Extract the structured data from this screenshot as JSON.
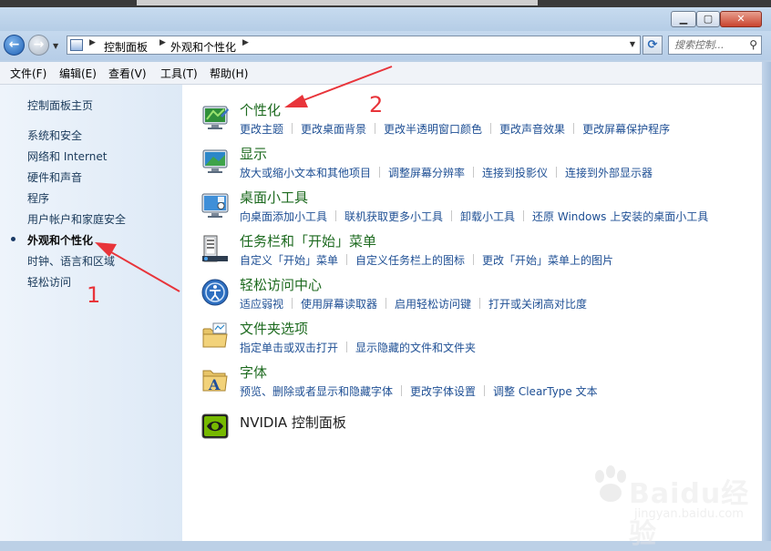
{
  "toolbar": {
    "search_placeholder": "搜索控制..."
  },
  "breadcrumb": {
    "part1": "控制面板",
    "part2": "外观和个性化"
  },
  "menu": [
    "文件(F)",
    "编辑(E)",
    "查看(V)",
    "工具(T)",
    "帮助(H)"
  ],
  "window_buttons": {
    "minimize": "▁",
    "maximize": "▢",
    "close": "✕"
  },
  "sidebar": {
    "home": "控制面板主页",
    "items": [
      "系统和安全",
      "网络和 Internet",
      "硬件和声音",
      "程序",
      "用户帐户和家庭安全",
      "外观和个性化",
      "时钟、语言和区域",
      "轻松访问"
    ],
    "active_index": 5
  },
  "categories": [
    {
      "title": "个性化",
      "icon": "personalization-icon",
      "links": [
        "更改主题",
        "更改桌面背景",
        "更改半透明窗口颜色",
        "更改声音效果",
        "更改屏幕保护程序"
      ]
    },
    {
      "title": "显示",
      "icon": "display-icon",
      "links": [
        "放大或缩小文本和其他项目",
        "调整屏幕分辨率",
        "连接到投影仪",
        "连接到外部显示器"
      ]
    },
    {
      "title": "桌面小工具",
      "icon": "gadgets-icon",
      "links": [
        "向桌面添加小工具",
        "联机获取更多小工具",
        "卸载小工具",
        "还原 Windows 上安装的桌面小工具"
      ]
    },
    {
      "title": "任务栏和「开始」菜单",
      "icon": "taskbar-icon",
      "links": [
        "自定义「开始」菜单",
        "自定义任务栏上的图标",
        "更改「开始」菜单上的图片"
      ]
    },
    {
      "title": "轻松访问中心",
      "icon": "ease-of-access-icon",
      "links": [
        "适应弱视",
        "使用屏幕读取器",
        "启用轻松访问键",
        "打开或关闭高对比度"
      ]
    },
    {
      "title": "文件夹选项",
      "icon": "folder-options-icon",
      "links": [
        "指定单击或双击打开",
        "显示隐藏的文件和文件夹"
      ]
    },
    {
      "title": "字体",
      "icon": "fonts-icon",
      "links": [
        "预览、删除或者显示和隐藏字体",
        "更改字体设置",
        "调整 ClearType 文本"
      ]
    },
    {
      "title": "NVIDIA 控制面板",
      "icon": "nvidia-icon",
      "links": []
    }
  ],
  "annotations": {
    "label1": "1",
    "label2": "2",
    "color": "#e8343a"
  },
  "watermark": {
    "logo": "Baidu经验",
    "url": "jingyan.baidu.com"
  }
}
